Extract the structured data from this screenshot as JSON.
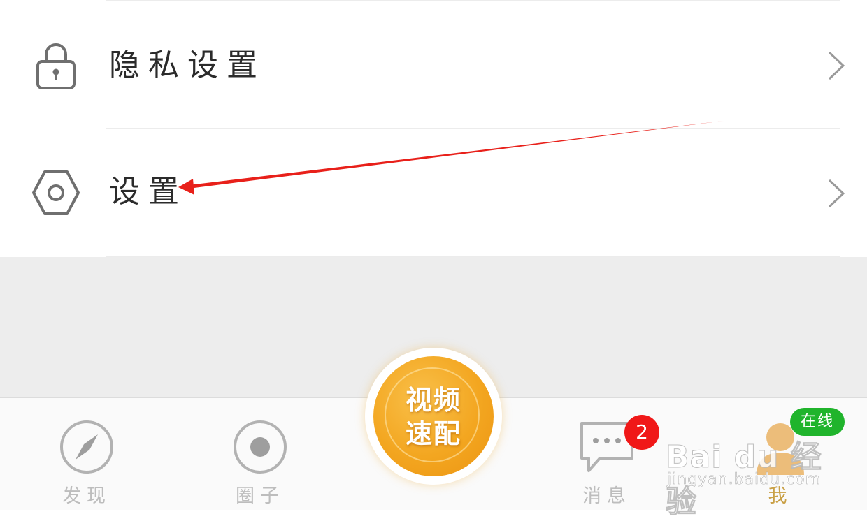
{
  "menu": {
    "items": [
      {
        "label": "隐私设置",
        "icon": "lock-icon"
      },
      {
        "label": "设置",
        "icon": "hexagon-settings-icon"
      }
    ]
  },
  "center_button": {
    "line1": "视频",
    "line2": "速配"
  },
  "tabs": [
    {
      "label": "发现",
      "icon": "compass-icon",
      "active": false
    },
    {
      "label": "圈子",
      "icon": "record-circle-icon",
      "active": false
    },
    {
      "label": "消息",
      "icon": "chat-bubble-icon",
      "active": false
    },
    {
      "label": "我",
      "icon": "person-avatar-icon",
      "active": true
    }
  ],
  "messages_badge": "2",
  "online_status": "在线",
  "watermark": {
    "brand": "Bai du 经验",
    "url": "jingyan.baidu.com"
  },
  "colors": {
    "annotation_arrow": "#e8201a",
    "center_button": "#f3a620",
    "badge": "#f01818",
    "online_pill": "#20b42c",
    "active_tab": "#c9a046",
    "inactive_tab": "#bdbdbd"
  }
}
